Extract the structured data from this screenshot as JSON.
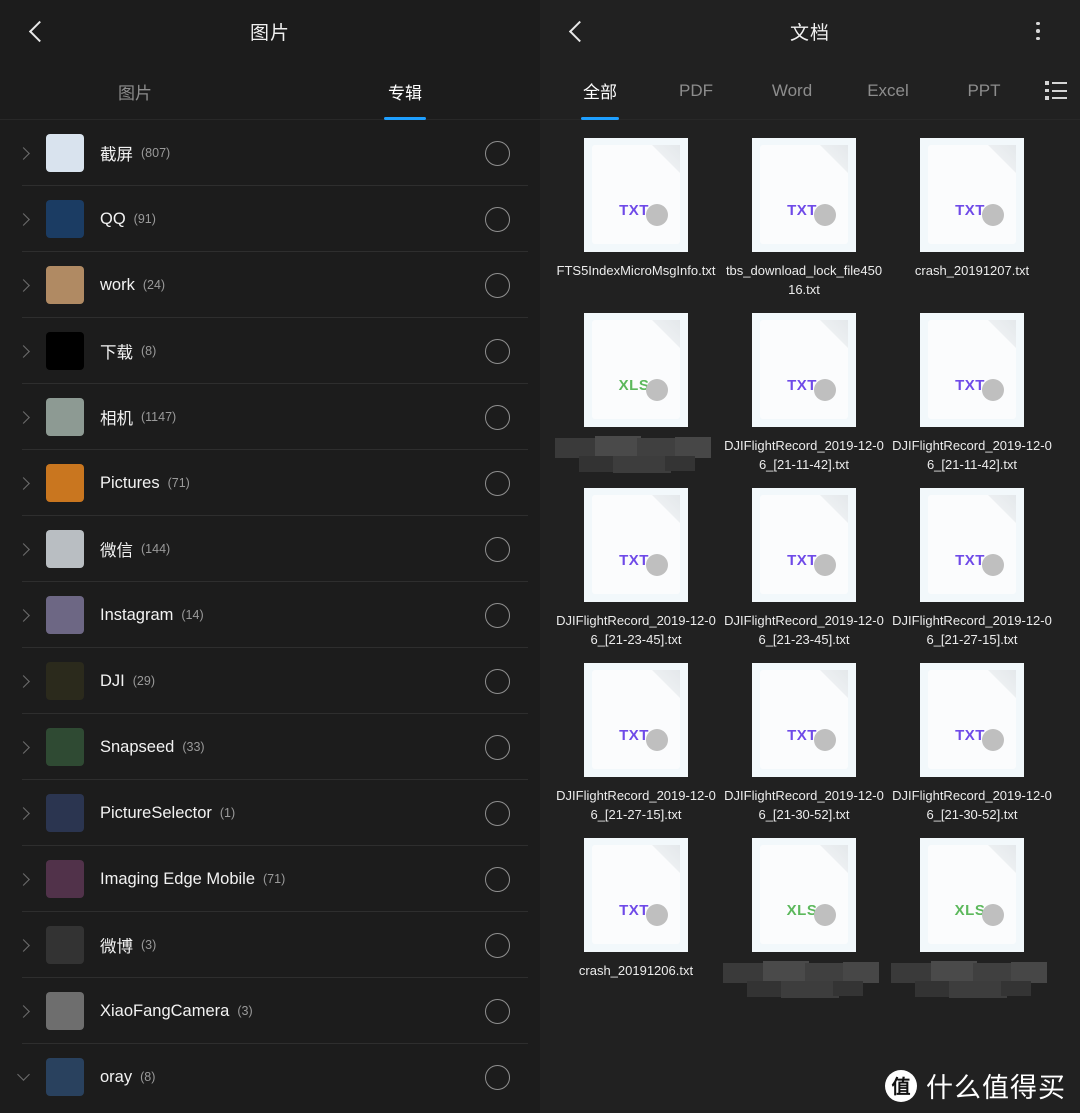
{
  "left_panel": {
    "header": {
      "back_icon": "chevron-left-icon",
      "title": "图片"
    },
    "tabs": [
      {
        "label": "图片",
        "active": false
      },
      {
        "label": "专辑",
        "active": true
      }
    ],
    "accent_color": "#1e9fff",
    "albums": [
      {
        "name": "截屏",
        "count": "(807)",
        "expanded": false,
        "thumb": "#d9e3ee"
      },
      {
        "name": "QQ",
        "count": "(91)",
        "expanded": false,
        "thumb": "#1b3c63"
      },
      {
        "name": "work",
        "count": "(24)",
        "expanded": false,
        "thumb": "#b08a63"
      },
      {
        "name": "下载",
        "count": "(8)",
        "expanded": false,
        "thumb": "#000000"
      },
      {
        "name": "相机",
        "count": "(1147)",
        "expanded": false,
        "thumb": "#8d9a93"
      },
      {
        "name": "Pictures",
        "count": "(71)",
        "expanded": false,
        "thumb": "#c9761f"
      },
      {
        "name": "微信",
        "count": "(144)",
        "expanded": false,
        "thumb": "#b9bec2"
      },
      {
        "name": "Instagram",
        "count": "(14)",
        "expanded": false,
        "thumb": "#6d6784"
      },
      {
        "name": "DJI",
        "count": "(29)",
        "expanded": false,
        "thumb": "#2b2a1c"
      },
      {
        "name": "Snapseed",
        "count": "(33)",
        "expanded": false,
        "thumb": "#2f4a33"
      },
      {
        "name": "PictureSelector",
        "count": "(1)",
        "expanded": false,
        "thumb": "#2b3550"
      },
      {
        "name": "Imaging Edge Mobile",
        "count": "(71)",
        "expanded": false,
        "thumb": "#51324a"
      },
      {
        "name": "微博",
        "count": "(3)",
        "expanded": false,
        "thumb": "#3a3churn"
      },
      {
        "name": "XiaoFangCamera",
        "count": "(3)",
        "expanded": false,
        "thumb": "#6e6e6e"
      },
      {
        "name": "oray",
        "count": "(8)",
        "expanded": true,
        "thumb": "#29415e"
      }
    ]
  },
  "right_panel": {
    "header": {
      "back_icon": "chevron-left-icon",
      "title": "文档",
      "more_icon": "overflow-menu-icon"
    },
    "tabs": [
      {
        "label": "全部",
        "active": true
      },
      {
        "label": "PDF",
        "active": false
      },
      {
        "label": "Word",
        "active": false
      },
      {
        "label": "Excel",
        "active": false
      },
      {
        "label": "PPT",
        "active": false
      }
    ],
    "list_view_icon": "list-view-icon",
    "accent_color": "#1e9fff",
    "files": [
      {
        "name": "FTS5IndexMicroMsgInfo.txt",
        "type": "TXT",
        "redacted": false
      },
      {
        "name": "tbs_download_lock_file45016.txt",
        "type": "TXT",
        "redacted": false
      },
      {
        "name": "crash_20191207.txt",
        "type": "TXT",
        "redacted": false
      },
      {
        "name": "",
        "type": "XLS",
        "redacted": true
      },
      {
        "name": "DJIFlightRecord_2019-12-06_[21-11-42].txt",
        "type": "TXT",
        "redacted": false
      },
      {
        "name": "DJIFlightRecord_2019-12-06_[21-11-42].txt",
        "type": "TXT",
        "redacted": false
      },
      {
        "name": "DJIFlightRecord_2019-12-06_[21-23-45].txt",
        "type": "TXT",
        "redacted": false
      },
      {
        "name": "DJIFlightRecord_2019-12-06_[21-23-45].txt",
        "type": "TXT",
        "redacted": false
      },
      {
        "name": "DJIFlightRecord_2019-12-06_[21-27-15].txt",
        "type": "TXT",
        "redacted": false
      },
      {
        "name": "DJIFlightRecord_2019-12-06_[21-27-15].txt",
        "type": "TXT",
        "redacted": false
      },
      {
        "name": "DJIFlightRecord_2019-12-06_[21-30-52].txt",
        "type": "TXT",
        "redacted": false
      },
      {
        "name": "DJIFlightRecord_2019-12-06_[21-30-52].txt",
        "type": "TXT",
        "redacted": false
      },
      {
        "name": "crash_20191206.txt",
        "type": "TXT",
        "redacted": false
      },
      {
        "name": "",
        "type": "XLS",
        "redacted": true
      },
      {
        "name": "",
        "type": "XLS",
        "redacted": true
      }
    ],
    "type_colors": {
      "TXT": "#6f4ae8",
      "XLS": "#5cb85c"
    }
  },
  "watermark": {
    "logo_char": "值",
    "text": "什么值得买"
  }
}
